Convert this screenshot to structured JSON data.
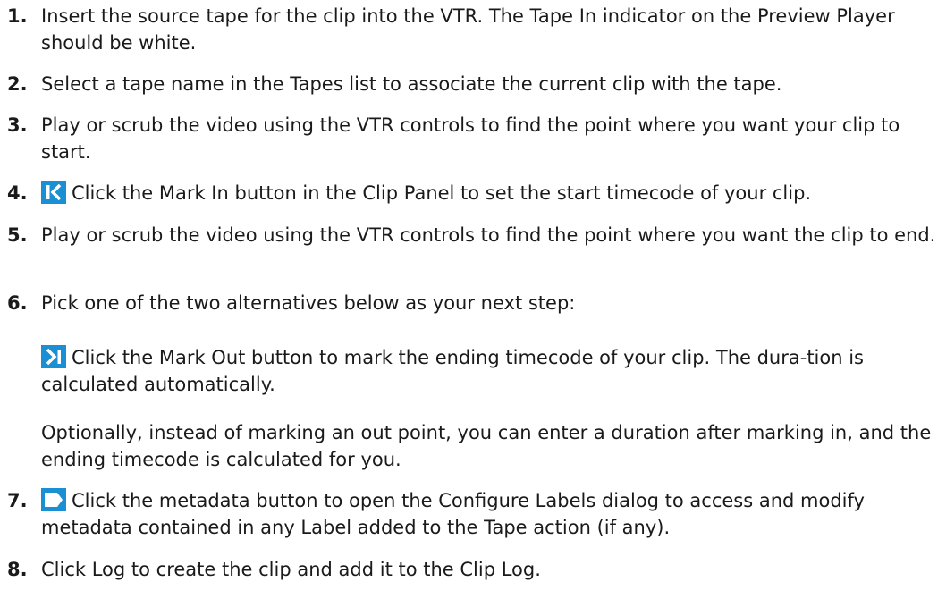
{
  "steps": [
    {
      "number": "1.",
      "text": "Insert the source tape for the clip into the VTR. The Tape In indicator on the Preview Player should be white."
    },
    {
      "number": "2.",
      "text": "Select a tape name in the Tapes list to associate the current clip with the tape."
    },
    {
      "number": "3.",
      "text": "Play or scrub the video using the VTR controls to find the point where you want your clip to start."
    },
    {
      "number": "4.",
      "icon": "mark-in-icon",
      "text": "Click the Mark In button in the Clip Panel to set the start timecode of your clip."
    },
    {
      "number": "5.",
      "text": "Play or scrub the video using the VTR controls to find the point where you want the clip to end."
    },
    {
      "number": "6.",
      "text": "Pick one of the two alternatives below as your next step:",
      "alternatives": [
        {
          "icon": "mark-out-icon",
          "text": "Click the Mark Out button to mark the ending timecode of your clip. The dura-tion is calculated automatically."
        },
        {
          "text": "Optionally, instead of marking an out point, you can enter a duration after marking in, and the ending timecode is calculated for you."
        }
      ]
    },
    {
      "number": "7.",
      "icon": "metadata-icon",
      "text": "Click the metadata button to open the Configure Labels dialog to access and modify metadata contained in any Label added to the Tape action (if any)."
    },
    {
      "number": "8.",
      "text": "Click Log to create the clip and add it to the Clip Log."
    }
  ],
  "colors": {
    "icon_blue": "#1a8fd4",
    "text": "#1a1a1a"
  }
}
